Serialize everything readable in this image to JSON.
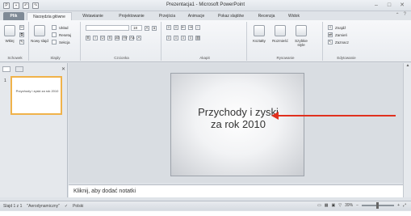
{
  "window": {
    "title": "Prezentacja1 - Microsoft PowerPoint"
  },
  "ribbon_tabs": [
    "Plik",
    "Narzędzia główne",
    "Wstawianie",
    "Projektowanie",
    "Przejścia",
    "Animacje",
    "Pokaz slajdów",
    "Recenzja",
    "Widok"
  ],
  "ribbon": {
    "clipboard": {
      "paste_label": "Wklej",
      "group_label": "Schowek"
    },
    "slides": {
      "new_slide_label": "Nowy slajd",
      "layout": "Układ",
      "reset": "Resetuj",
      "section": "Sekcja",
      "group_label": "Slajdy"
    },
    "font": {
      "size": "18",
      "group_label": "Czcionka"
    },
    "paragraph": {
      "group_label": "Akapit"
    },
    "drawing": {
      "shapes": "Kształty",
      "arrange": "Rozmieść",
      "quick_styles": "Szybkie style",
      "group_label": "Rysowanie"
    },
    "editing": {
      "find": "Znajdź",
      "replace": "Zamień",
      "select": "Zaznacz",
      "group_label": "Edytowanie"
    }
  },
  "thumbnails": {
    "slide_number": "1",
    "thumb_text": "Przychody i zyski za rok 2010"
  },
  "slide": {
    "title_line1": "Przychody i zyski",
    "title_line2": "za rok 2010"
  },
  "notes": {
    "placeholder": "Kliknij, aby dodać notatki"
  },
  "status": {
    "slide_info": "Slajd 1 z 1",
    "theme": "\"Aerodynamiczny\"",
    "language": "Polski",
    "zoom": "39%"
  },
  "annotation": {
    "arrow_color": "#e0301e"
  }
}
